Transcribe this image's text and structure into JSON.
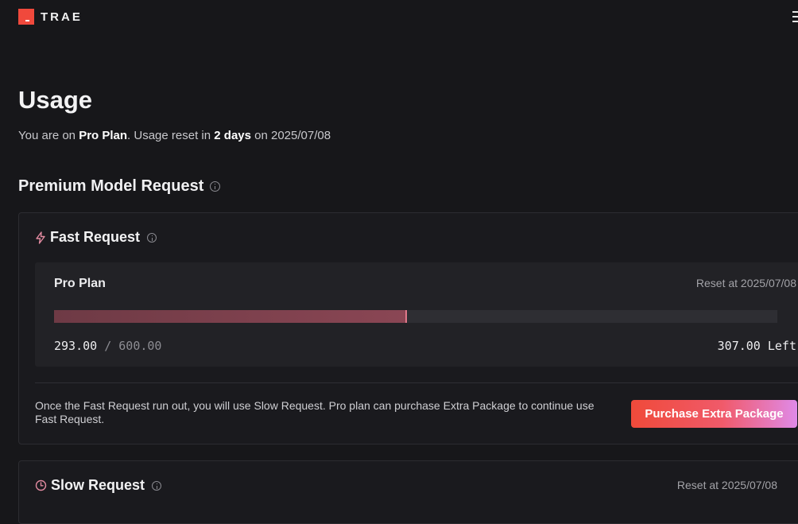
{
  "brand": {
    "name": "TRAE",
    "accent": "#f0493c"
  },
  "page": {
    "title": "Usage",
    "subtitle": {
      "prefix": "You are on ",
      "plan": "Pro Plan",
      "middle": ". Usage reset in ",
      "days": "2 days",
      "suffix": " on 2025/07/08"
    }
  },
  "premium": {
    "title": "Premium Model Request",
    "fast": {
      "title": "Fast Request",
      "plan_name": "Pro Plan",
      "reset": "Reset at 2025/07/08",
      "used": "293.00",
      "separator": " / ",
      "total": "600.00",
      "used_fraction": 0.4883,
      "left": "307.00 Left",
      "note": "Once the Fast Request run out, you will use Slow Request. Pro plan can purchase Extra Package to continue use Fast Request.",
      "purchase_label": "Purchase Extra Package"
    },
    "slow": {
      "title": "Slow Request",
      "reset": "Reset at 2025/07/08"
    }
  }
}
